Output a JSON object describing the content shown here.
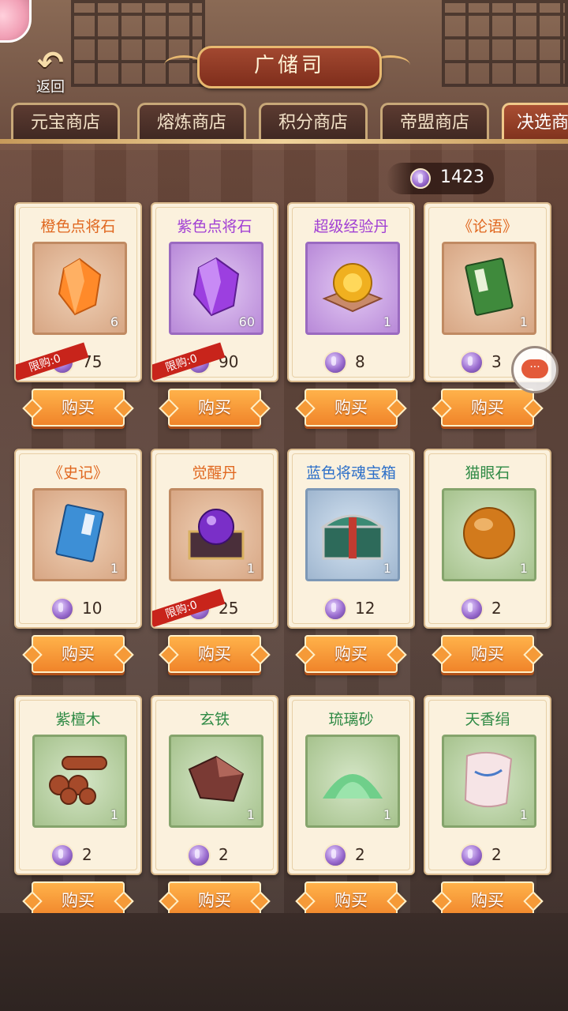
{
  "header": {
    "title": "广储司",
    "back_label": "返回"
  },
  "tabs": [
    {
      "label": "元宝商店",
      "active": false
    },
    {
      "label": "熔炼商店",
      "active": false
    },
    {
      "label": "积分商店",
      "active": false
    },
    {
      "label": "帝盟商店",
      "active": false
    },
    {
      "label": "决选商",
      "active": true
    }
  ],
  "currency": {
    "value": "1423",
    "icon": "purple-token-icon"
  },
  "limit_label": "限购:0",
  "buy_label": "购买",
  "items": [
    {
      "name": "橙色点将石",
      "rarity": "orange",
      "qty": "6",
      "price": "75",
      "limited": true,
      "icon": "orange-gem-icon"
    },
    {
      "name": "紫色点将石",
      "rarity": "purple",
      "qty": "60",
      "price": "90",
      "limited": true,
      "icon": "purple-gem-icon"
    },
    {
      "name": "超级经验丹",
      "rarity": "purple",
      "qty": "1",
      "price": "8",
      "limited": false,
      "icon": "gold-pill-icon"
    },
    {
      "name": "《论语》",
      "rarity": "orange",
      "qty": "1",
      "price": "3",
      "limited": false,
      "icon": "green-book-icon"
    },
    {
      "name": "《史记》",
      "rarity": "orange",
      "qty": "1",
      "price": "10",
      "limited": false,
      "icon": "blue-book-icon"
    },
    {
      "name": "觉醒丹",
      "rarity": "orange",
      "qty": "1",
      "price": "25",
      "limited": true,
      "icon": "purple-orb-box-icon"
    },
    {
      "name": "蓝色将魂宝箱",
      "rarity": "blue",
      "qty": "1",
      "price": "12",
      "limited": false,
      "icon": "treasure-chest-icon"
    },
    {
      "name": "猫眼石",
      "rarity": "green",
      "qty": "1",
      "price": "2",
      "limited": false,
      "icon": "amber-orb-icon"
    },
    {
      "name": "紫檀木",
      "rarity": "green",
      "qty": "1",
      "price": "2",
      "limited": false,
      "icon": "logs-icon"
    },
    {
      "name": "玄铁",
      "rarity": "green",
      "qty": "1",
      "price": "2",
      "limited": false,
      "icon": "iron-ore-icon"
    },
    {
      "name": "琉璃砂",
      "rarity": "green",
      "qty": "1",
      "price": "2",
      "limited": false,
      "icon": "green-sand-icon"
    },
    {
      "name": "天香绢",
      "rarity": "green",
      "qty": "1",
      "price": "2",
      "limited": false,
      "icon": "silk-cloth-icon"
    }
  ]
}
